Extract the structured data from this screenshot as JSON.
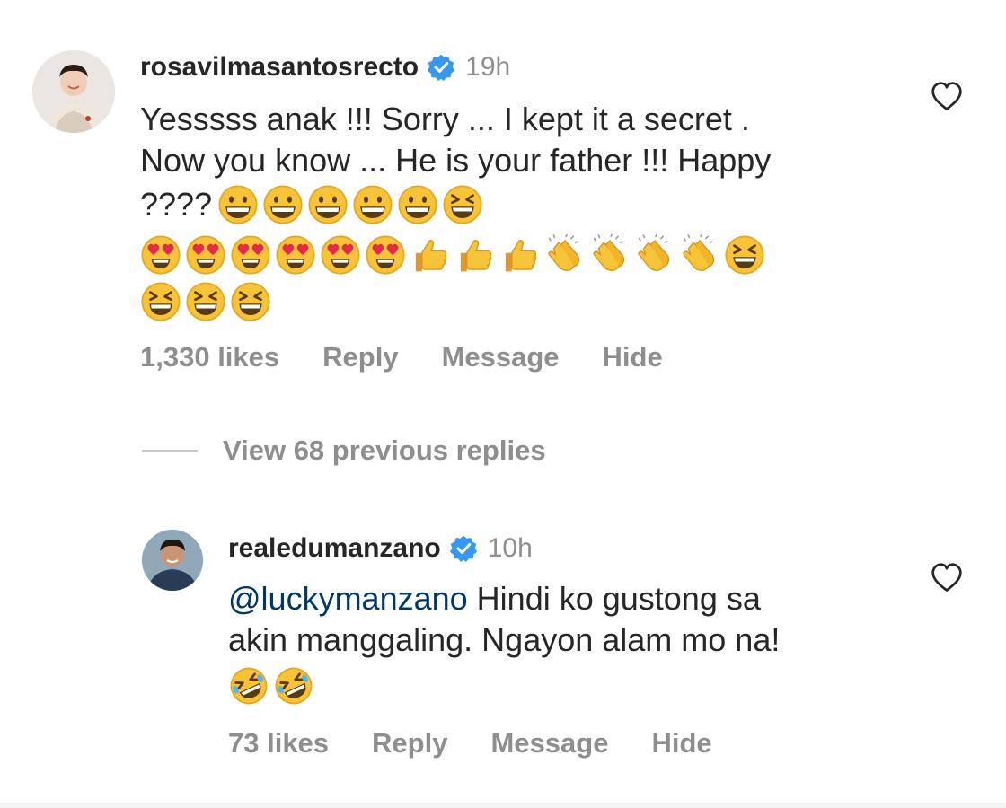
{
  "comments": [
    {
      "username": "rosavilmasantosrecto",
      "time": "19h",
      "text_lines": [
        "Yesssss anak !!! Sorry ... I kept it a secret .",
        "Now you know ... He is your father !!! Happy"
      ],
      "emoji_line_prefix": "????",
      "emoji_rows": [
        [
          "grin",
          "grin",
          "grin",
          "grin",
          "grin",
          "laugh-squint"
        ],
        [
          "heart-eyes",
          "heart-eyes",
          "heart-eyes",
          "heart-eyes",
          "heart-eyes",
          "heart-eyes",
          "thumbs-up",
          "thumbs-up",
          "thumbs-up",
          "clap",
          "clap",
          "clap",
          "clap",
          "laugh-squint"
        ],
        [
          "laugh-squint",
          "laugh-squint",
          "laugh-squint"
        ]
      ],
      "likes": "1,330 likes",
      "reply": "Reply",
      "message": "Message",
      "hide": "Hide"
    },
    {
      "username": "realedumanzano",
      "time": "10h",
      "mention": "@luckymanzano",
      "text_lines": [
        " Hindi ko gustong sa",
        "akin manggaling. Ngayon alam mo na!"
      ],
      "emoji_rows": [
        [
          "rofl",
          "rofl"
        ]
      ],
      "likes": "73 likes",
      "reply": "Reply",
      "message": "Message",
      "hide": "Hide"
    }
  ],
  "view_replies": "View 68 previous replies",
  "colors": {
    "verified": "#3897f0",
    "secondary_text": "#8e8e8e",
    "mention": "#00376b"
  },
  "icons": [
    "verified-badge-icon",
    "heart-outline-icon"
  ]
}
